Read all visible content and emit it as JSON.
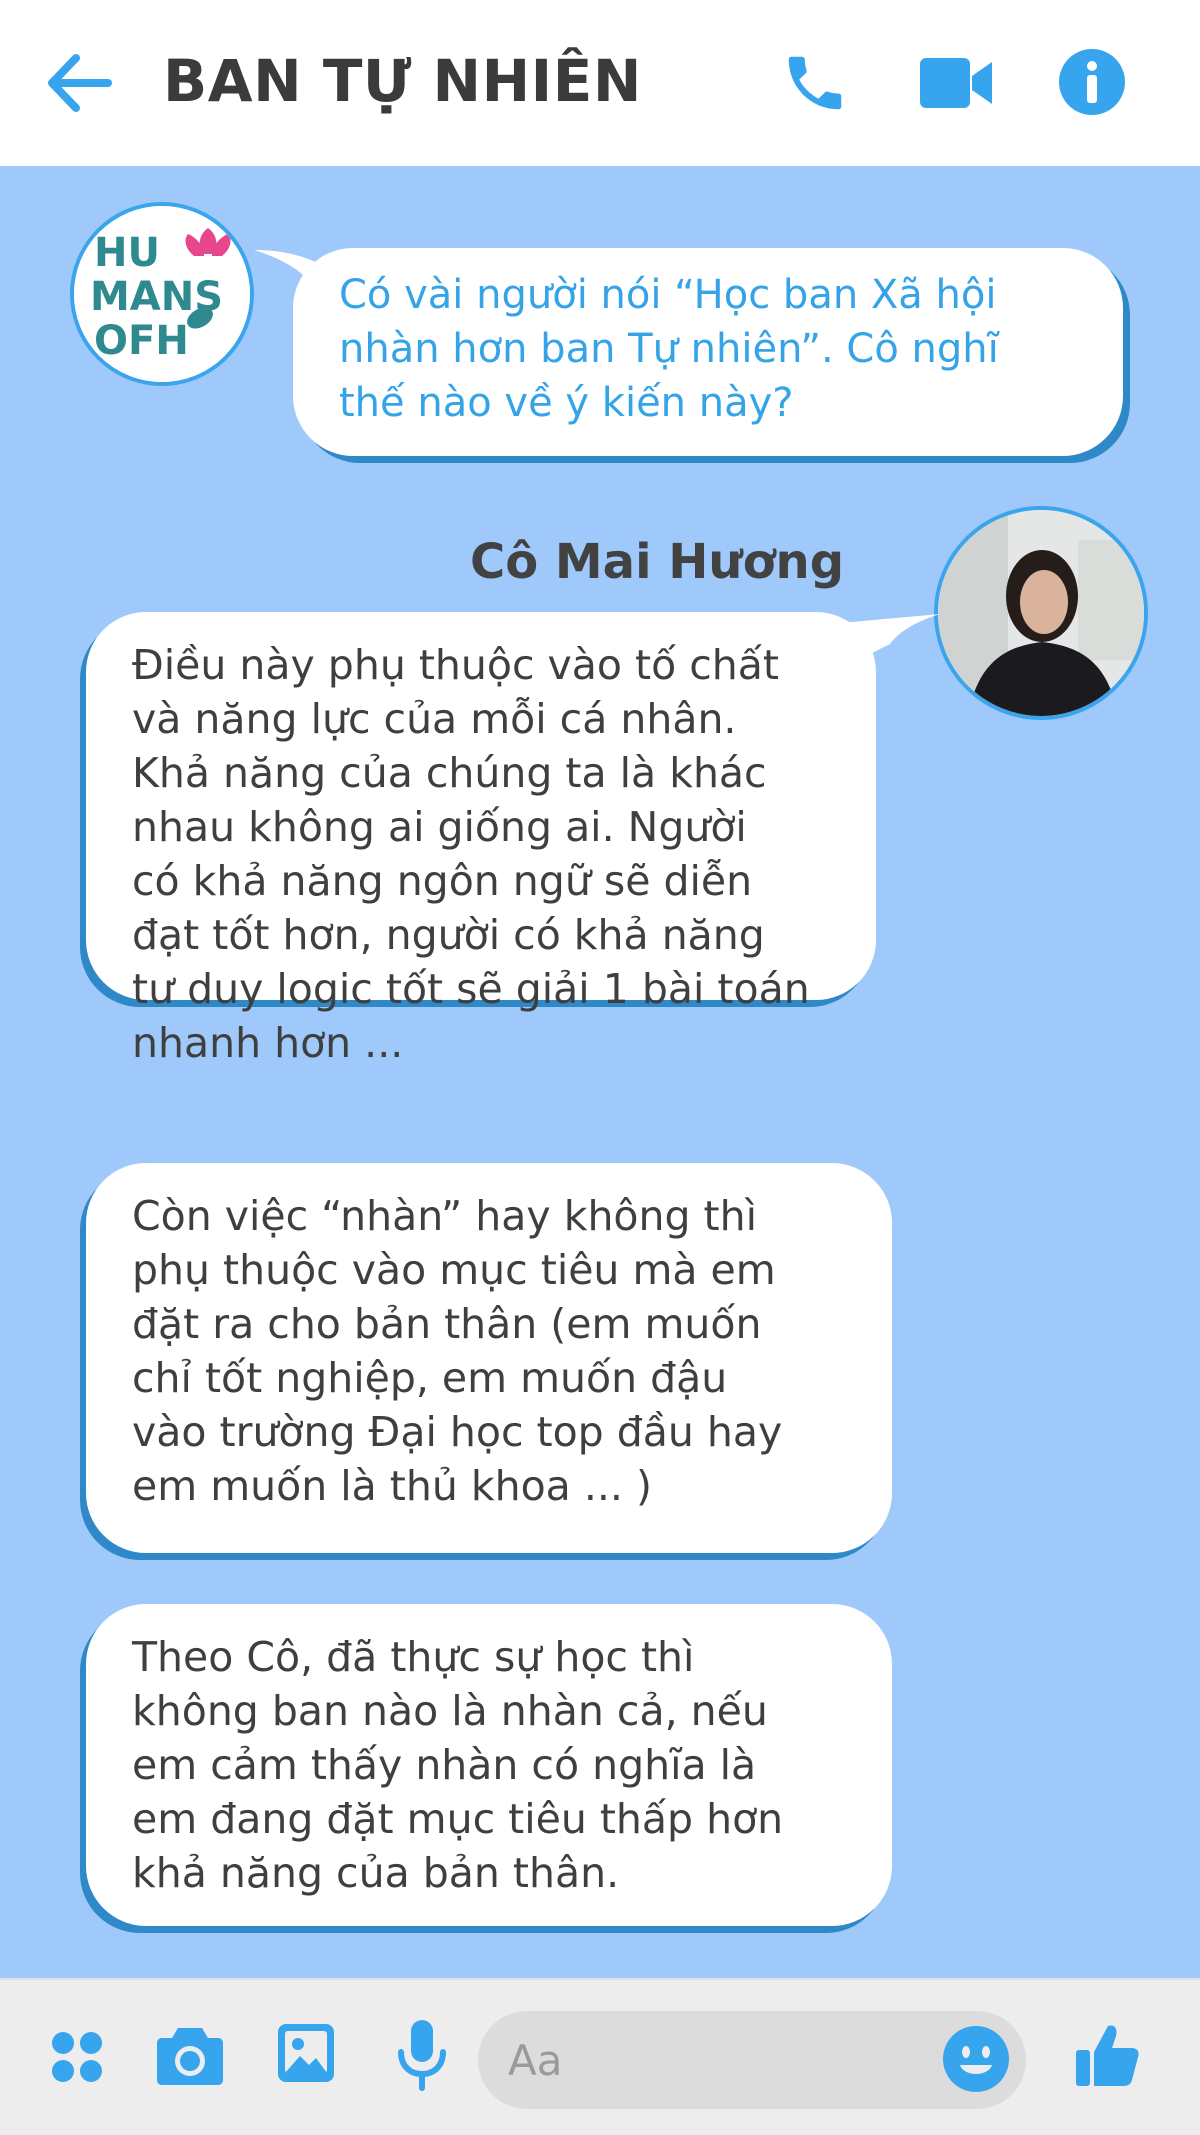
{
  "header": {
    "title": "BAN TỰ NHIÊN",
    "accent_color": "#37a4ee",
    "icons": [
      "back-arrow-icon",
      "phone-icon",
      "video-camera-icon",
      "info-icon"
    ]
  },
  "chat": {
    "background_color": "#9ec9fa",
    "question": {
      "sender_avatar_text": [
        "HU",
        "MANS",
        "OFH"
      ],
      "text": "Có vài người nói “Học ban Xã hội\nnhàn hơn ban Tự nhiên”. Cô nghĩ\nthế nào về ý kiến này?"
    },
    "reply_sender": "Cô Mai Hương",
    "replies": [
      {
        "text": "Điều này phụ thuộc vào tố chất\nvà năng lực của mỗi cá nhân.\nKhả năng của chúng ta là khác\nnhau không ai giống ai. Người\ncó khả năng ngôn ngữ sẽ diễn\nđạt tốt hơn, người có khả năng\ntư duy logic tốt sẽ giải 1 bài toán\nnhanh hơn ..."
      },
      {
        "text": "Còn việc “nhàn” hay không thì\nphụ thuộc vào mục tiêu mà em\nđặt ra cho bản thân (em muốn\nchỉ tốt nghiệp, em muốn đậu\nvào trường Đại học top đầu hay\nem muốn là thủ khoa ... )"
      },
      {
        "text": "Theo Cô, đã thực sự học thì\nkhông ban nào là nhàn cả, nếu\nem cảm thấy nhàn có nghĩa là\nem đang đặt mục tiêu thấp hơn\nkhả năng của bản thân."
      }
    ]
  },
  "composer": {
    "placeholder": "Aa",
    "icons": [
      "apps-icon",
      "camera-icon",
      "image-icon",
      "microphone-icon",
      "emoji-icon",
      "thumbs-up-icon"
    ]
  }
}
